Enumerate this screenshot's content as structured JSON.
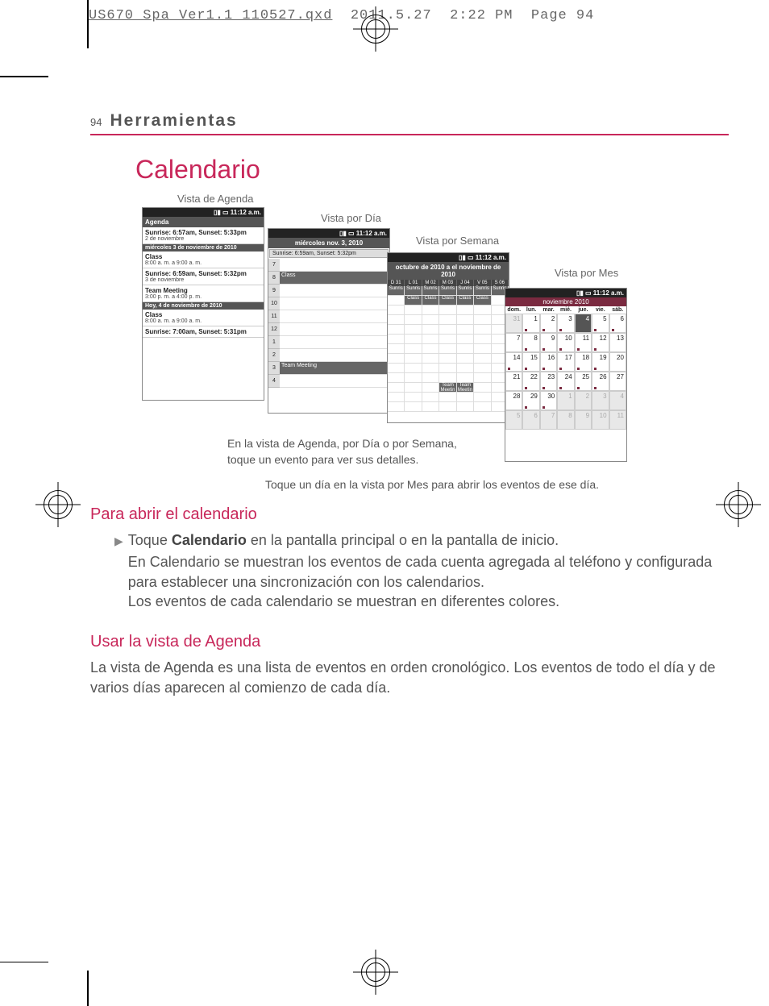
{
  "slug": {
    "file": "US670_Spa_Ver1.1_110527.qxd",
    "date": "2011.5.27",
    "time": "2:22 PM",
    "page_label": "Page 94"
  },
  "header": {
    "page_number": "94",
    "section": "Herramientas"
  },
  "title": "Calendario",
  "labels": {
    "agenda": "Vista de Agenda",
    "day": "Vista por Día",
    "week": "Vista por Semana",
    "month": "Vista por Mes"
  },
  "status_time": "11:12 a.m.",
  "agenda": {
    "title": "Agenda",
    "rows": [
      {
        "type": "sun",
        "text": "Sunrise: 6:57am, Sunset: 5:33pm",
        "sub": "2 de noviembre"
      },
      {
        "type": "day",
        "text": "miércoles 3 de noviembre de 2010"
      },
      {
        "type": "evt",
        "t1": "Class",
        "t2": "8:00 a. m. a 9:00 a. m."
      },
      {
        "type": "sun",
        "text": "Sunrise: 6:59am, Sunset: 5:32pm",
        "sub": "3 de noviembre"
      },
      {
        "type": "evt",
        "t1": "Team Meeting",
        "t2": "3:00 p. m. a 4:00 p. m."
      },
      {
        "type": "day",
        "text": "Hoy, 4 de noviembre de 2010"
      },
      {
        "type": "evt",
        "t1": "Class",
        "t2": "8:00 a. m. a 9:00 a. m."
      },
      {
        "type": "sun",
        "text": "Sunrise: 7:00am, Sunset: 5:31pm",
        "sub": ""
      }
    ]
  },
  "day": {
    "date": "miércoles nov. 3, 2010",
    "sunrise": "Sunrise: 6:59am, Sunset: 5:32pm",
    "hours": [
      "7",
      "8",
      "9",
      "10",
      "11",
      "12",
      "1",
      "2",
      "3",
      "4"
    ],
    "events": {
      "8": "Class",
      "3": "Team Meeting"
    }
  },
  "week": {
    "range": "octubre de 2010 a el noviembre de 2010",
    "cols": [
      "D 31",
      "L 01",
      "M 02",
      "M 03",
      "J 04",
      "V 05",
      "S 06"
    ],
    "sun_row": [
      "Sunris",
      "Sunris",
      "Sunris",
      "Sunris",
      "Sunris",
      "Sunris",
      "Sunris"
    ],
    "class_row_label": "Class",
    "team_label": "Team Meetin"
  },
  "month": {
    "title": "noviembre 2010",
    "dow": [
      "dom.",
      "lun.",
      "mar.",
      "mié.",
      "jue.",
      "vie.",
      "sáb."
    ],
    "grid": [
      [
        {
          "n": "31",
          "dim": true
        },
        {
          "n": "1",
          "t": 1
        },
        {
          "n": "2",
          "t": 1
        },
        {
          "n": "3",
          "t": 1
        },
        {
          "n": "4",
          "today": true
        },
        {
          "n": "5",
          "t": 1
        },
        {
          "n": "6",
          "t": 1
        }
      ],
      [
        {
          "n": "7"
        },
        {
          "n": "8",
          "t": 1
        },
        {
          "n": "9",
          "t": 1
        },
        {
          "n": "10",
          "t": 1
        },
        {
          "n": "11",
          "t": 1
        },
        {
          "n": "12",
          "t": 1
        },
        {
          "n": "13"
        }
      ],
      [
        {
          "n": "14",
          "t": 1
        },
        {
          "n": "15",
          "t": 1
        },
        {
          "n": "16",
          "t": 1
        },
        {
          "n": "17",
          "t": 1
        },
        {
          "n": "18",
          "t": 1
        },
        {
          "n": "19",
          "t": 1
        },
        {
          "n": "20"
        }
      ],
      [
        {
          "n": "21"
        },
        {
          "n": "22",
          "t": 1
        },
        {
          "n": "23",
          "t": 1
        },
        {
          "n": "24",
          "t": 1
        },
        {
          "n": "25",
          "t": 1
        },
        {
          "n": "26",
          "t": 1
        },
        {
          "n": "27"
        }
      ],
      [
        {
          "n": "28"
        },
        {
          "n": "29",
          "t": 1
        },
        {
          "n": "30",
          "t": 1
        },
        {
          "n": "1",
          "dim": true
        },
        {
          "n": "2",
          "dim": true
        },
        {
          "n": "3",
          "dim": true
        },
        {
          "n": "4",
          "dim": true
        }
      ],
      [
        {
          "n": "5",
          "dim": true
        },
        {
          "n": "6",
          "dim": true
        },
        {
          "n": "7",
          "dim": true
        },
        {
          "n": "8",
          "dim": true
        },
        {
          "n": "9",
          "dim": true
        },
        {
          "n": "10",
          "dim": true
        },
        {
          "n": "11",
          "dim": true
        }
      ]
    ]
  },
  "captions": {
    "c1a": "En la vista de Agenda, por Día o por Semana,",
    "c1b": "toque un evento para ver sus detalles.",
    "c2": "Toque un día en la vista por Mes para abrir los eventos de ese día."
  },
  "sec1": {
    "heading": "Para abrir el calendario",
    "bullet_pre": "Toque ",
    "bullet_bold": "Calendario",
    "bullet_post": " en la pantalla principal o en la pantalla de inicio.",
    "p1": "En Calendario se muestran los eventos de cada cuenta agregada al teléfono y configurada para establecer una sincronización con los calendarios.",
    "p2": "Los eventos de cada calendario se muestran en diferentes colores."
  },
  "sec2": {
    "heading": "Usar la vista de Agenda",
    "p": "La vista de Agenda es una lista de eventos en orden cronológico. Los eventos de todo el día y de varios días aparecen al comienzo de cada día."
  }
}
